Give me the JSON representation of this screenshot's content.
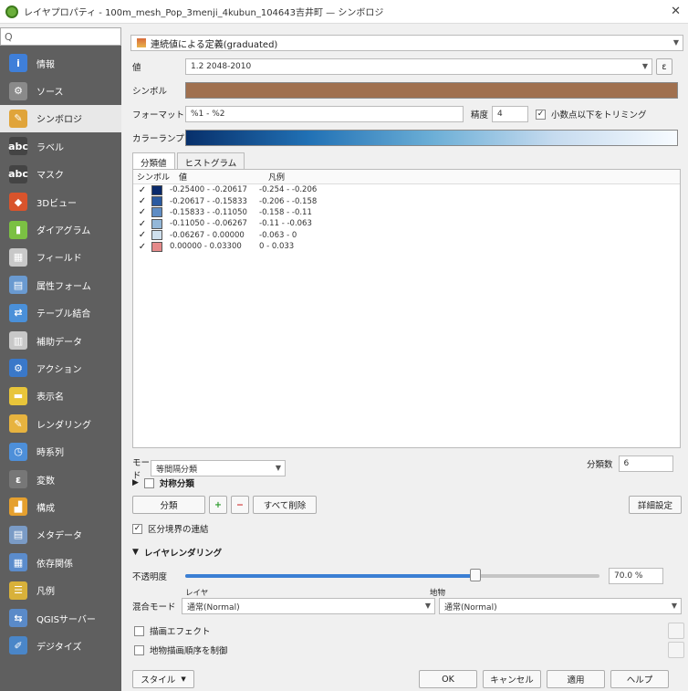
{
  "window": {
    "title": "レイヤプロパティ - 100m_mesh_Pop_3menji_4kubun_104643吉井町 — シンボロジ",
    "close": "✕"
  },
  "sidebar": {
    "search_placeholder": "Q",
    "items": [
      {
        "label": "情報",
        "icon": "info-icon",
        "color": "#3f7fd9",
        "glyph": "i"
      },
      {
        "label": "ソース",
        "icon": "source-icon",
        "color": "#8a8a8a",
        "glyph": "⚙"
      },
      {
        "label": "シンボロジ",
        "icon": "symbology-icon",
        "color": "#e0a43a",
        "glyph": "✎"
      },
      {
        "label": "ラベル",
        "icon": "labels-icon",
        "color": "#444",
        "glyph": "abc"
      },
      {
        "label": "マスク",
        "icon": "mask-icon",
        "color": "#444",
        "glyph": "abc"
      },
      {
        "label": "3Dビュー",
        "icon": "3d-view-icon",
        "color": "#d9542c",
        "glyph": "◆"
      },
      {
        "label": "ダイアグラム",
        "icon": "diagrams-icon",
        "color": "#7bc043",
        "glyph": "▮"
      },
      {
        "label": "フィールド",
        "icon": "fields-icon",
        "color": "#c8c8c8",
        "glyph": "▦"
      },
      {
        "label": "属性フォーム",
        "icon": "attributes-form-icon",
        "color": "#6a9ad0",
        "glyph": "▤"
      },
      {
        "label": "テーブル結合",
        "icon": "joins-icon",
        "color": "#4a90d9",
        "glyph": "⇄"
      },
      {
        "label": "補助データ",
        "icon": "auxiliary-storage-icon",
        "color": "#c8c8c8",
        "glyph": "▥"
      },
      {
        "label": "アクション",
        "icon": "actions-icon",
        "color": "#3a78c9",
        "glyph": "⚙"
      },
      {
        "label": "表示名",
        "icon": "display-icon",
        "color": "#e8c53a",
        "glyph": "▬"
      },
      {
        "label": "レンダリング",
        "icon": "rendering-icon",
        "color": "#e7b33f",
        "glyph": "✎"
      },
      {
        "label": "時系列",
        "icon": "temporal-icon",
        "color": "#4d8fd9",
        "glyph": "◷"
      },
      {
        "label": "変数",
        "icon": "variables-icon",
        "color": "#777",
        "glyph": "ε"
      },
      {
        "label": "構成",
        "icon": "elevation-icon",
        "color": "#e5a02f",
        "glyph": "▟"
      },
      {
        "label": "メタデータ",
        "icon": "metadata-icon",
        "color": "#7a9bc6",
        "glyph": "▤"
      },
      {
        "label": "依存関係",
        "icon": "dependencies-icon",
        "color": "#5b8ccc",
        "glyph": "▦"
      },
      {
        "label": "凡例",
        "icon": "legend-icon",
        "color": "#d8b13a",
        "glyph": "☰"
      },
      {
        "label": "QGISサーバー",
        "icon": "qgis-server-icon",
        "color": "#5a8ac8",
        "glyph": "⇆"
      },
      {
        "label": "デジタイズ",
        "icon": "digitizing-icon",
        "color": "#4a86c8",
        "glyph": "✐"
      }
    ]
  },
  "renderer": {
    "value": "連続値による定義(graduated)"
  },
  "value_row": {
    "label": "値",
    "value": "1.2 2048-2010",
    "expr_btn": "ε"
  },
  "symbol_row": {
    "label": "シンボル",
    "color": "#a0704f"
  },
  "format_row": {
    "label": "フォーマット",
    "value": "%1 - %2",
    "precision_label": "精度",
    "precision_value": "4",
    "trim_label": "小数点以下をトリミング"
  },
  "ramp_row": {
    "label": "カラーランプ"
  },
  "tabs": [
    "分類値",
    "ヒストグラム"
  ],
  "table": {
    "headers": {
      "symbol": "シンボル",
      "value": "値",
      "legend": "凡例"
    },
    "rows": [
      {
        "color": "#0a2a6b",
        "value": "-0.25400 - -0.20617",
        "legend": "-0.254 - -0.206"
      },
      {
        "color": "#2a5aa0",
        "value": "-0.20617 - -0.15833",
        "legend": "-0.206 - -0.158"
      },
      {
        "color": "#5e8cc4",
        "value": "-0.15833 - -0.11050",
        "legend": "-0.158 - -0.11"
      },
      {
        "color": "#93b7d8",
        "value": "-0.11050 - -0.06267",
        "legend": "-0.11 - -0.063"
      },
      {
        "color": "#cfe0ee",
        "value": "-0.06267 - 0.00000",
        "legend": "-0.063 - 0"
      },
      {
        "color": "#e58a8a",
        "value": "0.00000 - 0.03300",
        "legend": "0 - 0.033"
      }
    ]
  },
  "mode_row": {
    "label": "モード",
    "value": "等間隔分類",
    "classes_label": "分類数",
    "classes_value": "6"
  },
  "symmetric": {
    "label": "対称分類"
  },
  "buttons": {
    "classify": "分類",
    "add": "+",
    "remove": "−",
    "delete_all": "すべて削除",
    "advanced": "詳細設定"
  },
  "link_boundaries": {
    "label": "区分境界の連結"
  },
  "layer_rendering": {
    "title": "レイヤレンダリング"
  },
  "opacity": {
    "label": "不透明度",
    "value_text": "70.0 %",
    "percent": 70
  },
  "blend": {
    "label": "混合モード",
    "layer_label": "レイヤ",
    "layer_value": "通常(Normal)",
    "feature_label": "地物",
    "feature_value": "通常(Normal)"
  },
  "effects": {
    "label": "描画エフェクト"
  },
  "feature_order": {
    "label": "地物描画順序を制御"
  },
  "footer": {
    "style": "スタイル",
    "ok": "OK",
    "cancel": "キャンセル",
    "apply": "適用",
    "help": "ヘルプ"
  }
}
